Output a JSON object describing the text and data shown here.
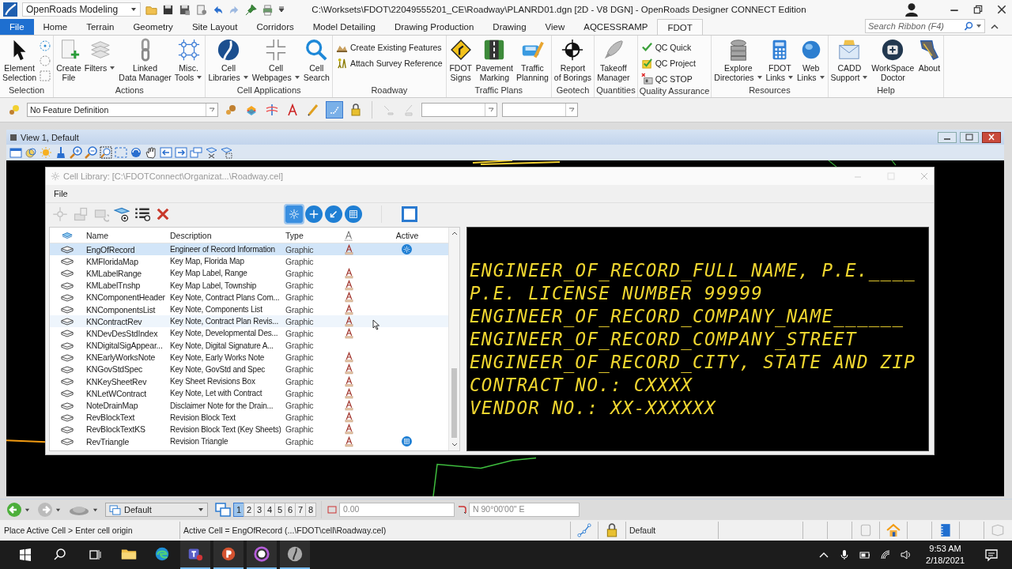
{
  "title_bar": {
    "workflow": "OpenRoads Modeling",
    "title": "C:\\Worksets\\FDOT\\22049555201_CE\\Roadway\\PLANRD01.dgn [2D - V8 DGN] - OpenRoads Designer CONNECT Edition"
  },
  "ribbon_tabs": [
    {
      "label": "File",
      "kind": "backstage",
      "selected": false
    },
    {
      "label": "Home",
      "kind": "tab",
      "selected": false
    },
    {
      "label": "Terrain",
      "kind": "tab",
      "selected": false
    },
    {
      "label": "Geometry",
      "kind": "tab",
      "selected": false
    },
    {
      "label": "Site Layout",
      "kind": "tab",
      "selected": false
    },
    {
      "label": "Corridors",
      "kind": "tab",
      "selected": false
    },
    {
      "label": "Model Detailing",
      "kind": "tab",
      "selected": false
    },
    {
      "label": "Drawing Production",
      "kind": "tab",
      "selected": false
    },
    {
      "label": "Drawing",
      "kind": "tab",
      "selected": false
    },
    {
      "label": "View",
      "kind": "tab",
      "selected": false
    },
    {
      "label": "AQCESSRAMP",
      "kind": "tab",
      "selected": false
    },
    {
      "label": "FDOT",
      "kind": "tab",
      "selected": true
    }
  ],
  "ribbon_search": {
    "placeholder": "Search Ribbon (F4)"
  },
  "ribbon_groups": [
    {
      "label": "Selection",
      "tools": [
        {
          "kind": "large",
          "lines": [
            "Element",
            "Selection"
          ],
          "dropdown": false
        }
      ]
    },
    {
      "label": "Actions",
      "tools": [
        {
          "kind": "large",
          "lines": [
            "Create",
            "File"
          ],
          "dropdown": false
        },
        {
          "kind": "large",
          "lines": [
            "Filters"
          ],
          "dropdown": true
        },
        {
          "kind": "large",
          "lines": [
            "Linked",
            "Data Manager"
          ],
          "dropdown": false
        },
        {
          "kind": "large",
          "lines": [
            "Misc.",
            "Tools"
          ],
          "dropdown": true
        }
      ]
    },
    {
      "label": "Cell Applications",
      "tools": [
        {
          "kind": "large",
          "lines": [
            "Cell",
            "Libraries"
          ],
          "dropdown": true
        },
        {
          "kind": "large",
          "lines": [
            "Cell",
            "Webpages"
          ],
          "dropdown": true
        },
        {
          "kind": "large",
          "lines": [
            "Cell",
            "Search"
          ],
          "dropdown": false
        }
      ]
    },
    {
      "label": "Roadway",
      "tools": [
        {
          "kind": "small",
          "lines": [
            "Create Existing Features"
          ],
          "dropdown": false
        },
        {
          "kind": "small",
          "lines": [
            "Attach Survey Reference"
          ],
          "dropdown": false
        }
      ]
    },
    {
      "label": "Traffic Plans",
      "tools": [
        {
          "kind": "large",
          "lines": [
            "FDOT",
            "Signs"
          ],
          "dropdown": false
        },
        {
          "kind": "large",
          "lines": [
            "Pavement",
            "Marking"
          ],
          "dropdown": false
        },
        {
          "kind": "large",
          "lines": [
            "Traffic",
            "Planning"
          ],
          "dropdown": false
        }
      ]
    },
    {
      "label": "Geotech",
      "tools": [
        {
          "kind": "large",
          "lines": [
            "Report",
            "of Borings"
          ],
          "dropdown": false
        }
      ]
    },
    {
      "label": "Quantities",
      "tools": [
        {
          "kind": "large",
          "lines": [
            "Takeoff",
            "Manager"
          ],
          "dropdown": false
        }
      ]
    },
    {
      "label": "Quality Assurance",
      "tools": [
        {
          "kind": "small",
          "lines": [
            "QC Quick"
          ],
          "dropdown": false
        },
        {
          "kind": "small",
          "lines": [
            "QC Project"
          ],
          "dropdown": false
        },
        {
          "kind": "small",
          "lines": [
            "QC STOP"
          ],
          "dropdown": false
        }
      ]
    },
    {
      "label": "Resources",
      "tools": [
        {
          "kind": "large",
          "lines": [
            "Explore",
            "Directories"
          ],
          "dropdown": true
        },
        {
          "kind": "large",
          "lines": [
            "FDOT",
            "Links"
          ],
          "dropdown": true
        },
        {
          "kind": "large",
          "lines": [
            "Web",
            "Links"
          ],
          "dropdown": true
        }
      ]
    },
    {
      "label": "Help",
      "tools": [
        {
          "kind": "large",
          "lines": [
            "CADD",
            "Support"
          ],
          "dropdown": true
        },
        {
          "kind": "large",
          "lines": [
            "WorkSpace",
            "Doctor"
          ],
          "dropdown": false
        },
        {
          "kind": "large",
          "lines": [
            "About"
          ],
          "dropdown": false
        }
      ]
    }
  ],
  "feature_toolbar": {
    "feature_definition": "No Feature Definition"
  },
  "view": {
    "title": "View 1, Default"
  },
  "cell_library": {
    "title": "Cell Library: [C:\\FDOTConnect\\Organizat...\\Roadway.cel]",
    "menu": [
      "File"
    ],
    "placement_modes": [
      {
        "selected": true
      },
      {
        "selected": false
      },
      {
        "selected": false
      },
      {
        "selected": false
      }
    ],
    "columns": [
      "Name",
      "Description",
      "Type",
      "Active"
    ],
    "rows": [
      {
        "name": "EngOfRecord",
        "description": "Engineer of Record Information",
        "type": "Graphic",
        "annotation": true,
        "active": true,
        "kind": "placement",
        "selected": true,
        "hovered": false
      },
      {
        "name": "KMFloridaMap",
        "description": "Key Map, Florida Map",
        "type": "Graphic",
        "annotation": false,
        "selected": false,
        "hovered": false
      },
      {
        "name": "KMLabelRange",
        "description": "Key Map Label, Range",
        "type": "Graphic",
        "annotation": true,
        "selected": false,
        "hovered": false
      },
      {
        "name": "KMLabelTnshp",
        "description": "Key Map Label, Township",
        "type": "Graphic",
        "annotation": true,
        "selected": false,
        "hovered": false
      },
      {
        "name": "KNComponentHeader",
        "description": "Key Note, Contract Plans Com...",
        "type": "Graphic",
        "annotation": true,
        "selected": false,
        "hovered": false
      },
      {
        "name": "KNComponentsList",
        "description": "Key Note, Components List",
        "type": "Graphic",
        "annotation": true,
        "selected": false,
        "hovered": false
      },
      {
        "name": "KNContractRev",
        "description": "Key Note, Contract Plan Revis...",
        "type": "Graphic",
        "annotation": true,
        "selected": false,
        "hovered": true
      },
      {
        "name": "KNDevDesStdIndex",
        "description": "Key Note, Developmental Des...",
        "type": "Graphic",
        "annotation": true,
        "selected": false,
        "hovered": false
      },
      {
        "name": "KNDigitalSigAppear...",
        "description": "Key Note, Digital Signature A...",
        "type": "Graphic",
        "annotation": false,
        "selected": false,
        "hovered": false
      },
      {
        "name": "KNEarlyWorksNote",
        "description": "Key Note, Early Works Note",
        "type": "Graphic",
        "annotation": true,
        "selected": false,
        "hovered": false
      },
      {
        "name": "KNGovStdSpec",
        "description": "Key Note, GovStd and Spec",
        "type": "Graphic",
        "annotation": true,
        "selected": false,
        "hovered": false
      },
      {
        "name": "KNKeySheetRev",
        "description": "Key Sheet Revisions Box",
        "type": "Graphic",
        "annotation": true,
        "selected": false,
        "hovered": false
      },
      {
        "name": "KNLetWContract",
        "description": "Key Note, Let with Contract",
        "type": "Graphic",
        "annotation": true,
        "selected": false,
        "hovered": false
      },
      {
        "name": "NoteDrainMap",
        "description": "Disclaimer Note for the Drain...",
        "type": "Graphic",
        "annotation": true,
        "selected": false,
        "hovered": false
      },
      {
        "name": "RevBlockText",
        "description": "Revision Block Text",
        "type": "Graphic",
        "annotation": true,
        "selected": false,
        "hovered": false
      },
      {
        "name": "RevBlockTextKS",
        "description": "Revision Block Text (Key Sheets)",
        "type": "Graphic",
        "annotation": true,
        "selected": false,
        "hovered": false
      },
      {
        "name": "RevTriangle",
        "description": "Revision Triangle",
        "type": "Graphic",
        "annotation": true,
        "active": true,
        "kind": "pattern",
        "selected": false,
        "hovered": false
      }
    ],
    "preview_lines": [
      "ENGINEER_OF_RECORD_FULL_NAME, P.E.____",
      "P.E. LICENSE NUMBER 99999",
      "ENGINEER_OF_RECORD_COMPANY_NAME______",
      "ENGINEER_OF_RECORD_COMPANY_STREET",
      "ENGINEER_OF_RECORD_CITY, STATE AND ZIP",
      "CONTRACT NO.: CXXXX",
      "VENDOR NO.: XX-XXXXXX"
    ]
  },
  "bottom_toolbar": {
    "view_group": "Default",
    "views": [
      {
        "label": "1",
        "selected": true
      },
      {
        "label": "2",
        "selected": false
      },
      {
        "label": "3",
        "selected": false
      },
      {
        "label": "4",
        "selected": false
      },
      {
        "label": "5",
        "selected": false
      },
      {
        "label": "6",
        "selected": false
      },
      {
        "label": "7",
        "selected": false
      },
      {
        "label": "8",
        "selected": false
      }
    ],
    "distance": "0.00",
    "direction": "N 90°00'00\" E"
  },
  "status_bar": {
    "prompt": "Place Active Cell > Enter cell origin",
    "message": "Active Cell = EngOfRecord (...\\FDOT\\cell\\Roadway.cel)",
    "level": "Default"
  },
  "taskbar": {
    "apps": [
      {
        "running": false
      },
      {
        "running": false
      },
      {
        "running": true
      },
      {
        "running": true
      },
      {
        "running": true
      },
      {
        "running": true
      }
    ],
    "time": "9:53 AM",
    "date": "2/18/2021"
  }
}
